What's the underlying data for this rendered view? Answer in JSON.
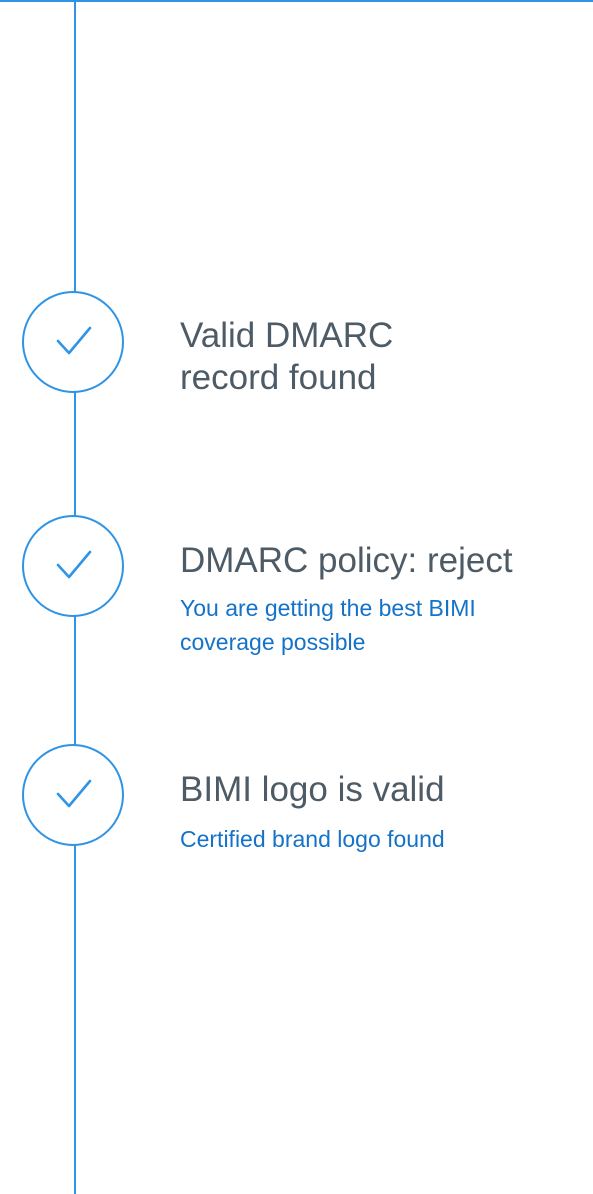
{
  "colors": {
    "accent": "#2f94e6",
    "title_text": "#4d5b66",
    "subtitle_text": "#1472c8",
    "background": "#ffffff"
  },
  "steps": [
    {
      "icon": "check-icon",
      "title_line1": "Valid DMARC",
      "title_line2": "record found"
    },
    {
      "icon": "check-icon",
      "title": "DMARC policy: reject",
      "subtitle_line1": "You are getting the best BIMI",
      "subtitle_line2": "coverage possible"
    },
    {
      "icon": "check-icon",
      "title": "BIMI logo is valid",
      "subtitle": "Certified brand logo found"
    }
  ]
}
